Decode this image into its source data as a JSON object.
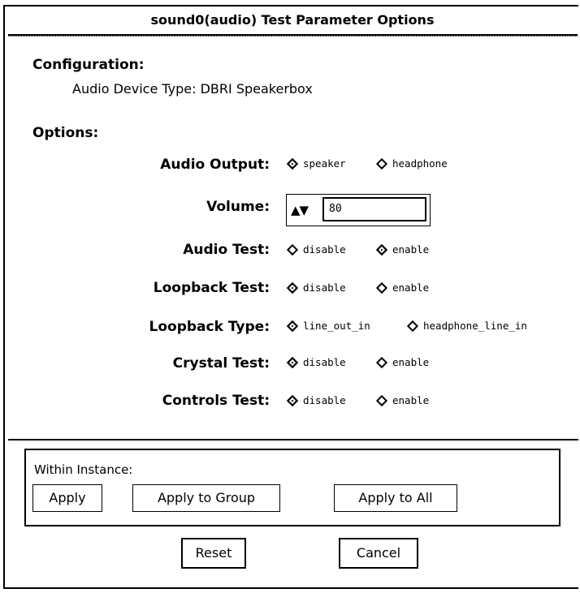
{
  "window": {
    "title": "sound0(audio) Test Parameter Options"
  },
  "configuration": {
    "heading": "Configuration:",
    "device_type": "Audio Device Type: DBRI Speakerbox"
  },
  "options": {
    "heading": "Options:",
    "audio_output": {
      "label": "Audio Output:",
      "choices": [
        "speaker",
        "headphone"
      ],
      "selected": "speaker"
    },
    "volume": {
      "label": "Volume:",
      "value": "80",
      "arrows": "▲▼"
    },
    "audio_test": {
      "label": "Audio Test:",
      "choices": [
        "disable",
        "enable"
      ],
      "selected": "enable"
    },
    "loopback_test": {
      "label": "Loopback Test:",
      "choices": [
        "disable",
        "enable"
      ],
      "selected": "disable"
    },
    "loopback_type": {
      "label": "Loopback Type:",
      "choices": [
        "line_out_in",
        "headphone_line_in"
      ],
      "selected": "line_out_in"
    },
    "crystal_test": {
      "label": "Crystal Test:",
      "choices": [
        "disable",
        "enable"
      ],
      "selected": "disable"
    },
    "controls_test": {
      "label": "Controls Test:",
      "choices": [
        "disable",
        "enable"
      ],
      "selected": "disable"
    }
  },
  "instance": {
    "title": "Within Instance:",
    "apply": "Apply",
    "apply_group": "Apply to Group",
    "apply_all": "Apply to All"
  },
  "footer": {
    "reset": "Reset",
    "cancel": "Cancel"
  }
}
